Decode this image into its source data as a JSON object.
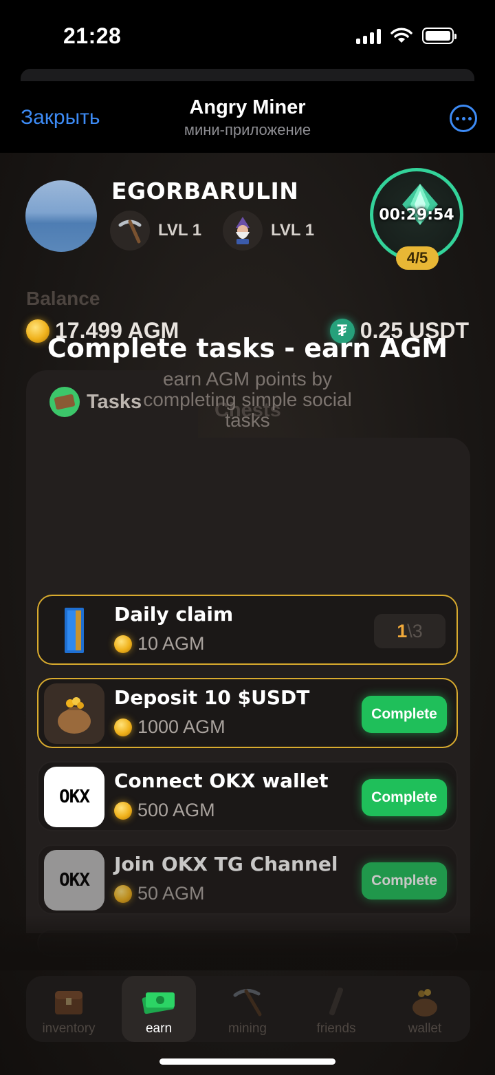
{
  "status_bar": {
    "time": "21:28"
  },
  "header": {
    "close_label": "Закрыть",
    "title": "Angry Miner",
    "subtitle": "мини-приложение"
  },
  "profile": {
    "username": "EGORBARULIN",
    "levels": [
      {
        "icon": "pickaxe-icon",
        "label": "LVL 1"
      },
      {
        "icon": "gnome-icon",
        "label": "LVL 1"
      }
    ],
    "timer": "00:29:54",
    "timer_count": "4/5"
  },
  "balance": {
    "label": "Balance",
    "agm": "17.499 AGM",
    "usdt": "0.25 USDT"
  },
  "tabs": [
    {
      "label": "Tasks",
      "active": true
    },
    {
      "label": "Chests",
      "active": false
    }
  ],
  "panel": {
    "title": "Complete tasks - earn AGM",
    "subtitle": "earn AGM points by completing simple social tasks"
  },
  "tasks": [
    {
      "name": "Daily claim",
      "reward": "10 AGM",
      "progress_current": "1",
      "progress_sep": "\\",
      "progress_total": "3",
      "highlight": true
    },
    {
      "name": "Deposit 10 $USDT",
      "reward": "1000 AGM",
      "action": "Complete",
      "highlight": true
    },
    {
      "name": "Connect OKX wallet",
      "reward": "500 AGM",
      "action": "Complete",
      "highlight": false
    },
    {
      "name": "Join OKX TG Channel",
      "reward": "50 AGM",
      "action": "Complete",
      "highlight": false
    }
  ],
  "okx_logo": "OKX",
  "nav": [
    {
      "label": "inventory",
      "icon": "chest-icon"
    },
    {
      "label": "earn",
      "icon": "money-icon",
      "active": true
    },
    {
      "label": "mining",
      "icon": "pickaxe-icon"
    },
    {
      "label": "friends",
      "icon": "friends-icon"
    },
    {
      "label": "wallet",
      "icon": "bag-icon"
    }
  ],
  "colors": {
    "accent_green": "#1fbf5a",
    "gold": "#d9ab2e",
    "telegram_blue": "#3d8bf5",
    "ring": "#33d39a"
  }
}
